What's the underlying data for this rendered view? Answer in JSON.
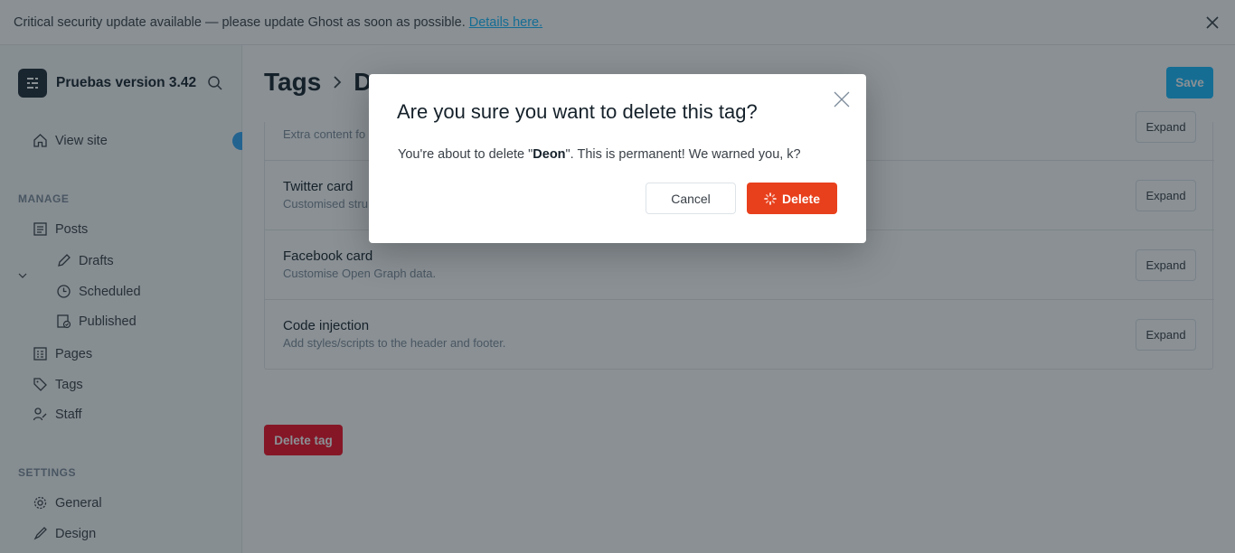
{
  "banner": {
    "text": "Critical security update available — please update Ghost as soon as possible.",
    "link": "Details here."
  },
  "sidebar": {
    "site_title": "Pruebas version 3.42",
    "view_site": "View site",
    "manage_label": "MANAGE",
    "settings_label": "SETTINGS",
    "posts": "Posts",
    "drafts": "Drafts",
    "scheduled": "Scheduled",
    "published": "Published",
    "pages": "Pages",
    "tags": "Tags",
    "staff": "Staff",
    "general": "General",
    "design": "Design"
  },
  "header": {
    "title": "Tags",
    "crumb": "De",
    "save": "Save"
  },
  "rows": [
    {
      "title": "",
      "desc": "Extra content fo",
      "action": "Expand"
    },
    {
      "title": "Twitter card",
      "desc": "Customised stru",
      "action": "Expand"
    },
    {
      "title": "Facebook card",
      "desc": "Customise Open Graph data.",
      "action": "Expand"
    },
    {
      "title": "Code injection",
      "desc": "Add styles/scripts to the header and footer.",
      "action": "Expand"
    }
  ],
  "delete_tag": "Delete tag",
  "modal": {
    "title": "Are you sure you want to delete this tag?",
    "body_prefix": "You're about to delete \"",
    "tag_name": "Deon",
    "body_suffix": "\". This is permanent! We warned you, k?",
    "cancel": "Cancel",
    "confirm": "Delete"
  },
  "colors": {
    "accent": "#14b8ff",
    "danger": "#e8401c"
  }
}
